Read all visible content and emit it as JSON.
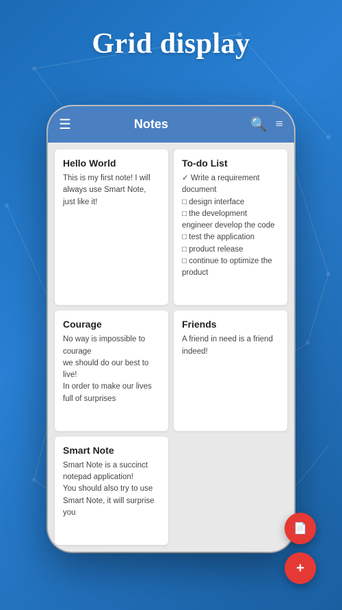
{
  "page": {
    "title": "Grid display",
    "background_color": "#2275c4"
  },
  "app": {
    "bar_title": "Notes",
    "menu_icon": "☰",
    "search_icon": "🔍",
    "filter_icon": "≡"
  },
  "notes": [
    {
      "id": "hello-world",
      "title": "Hello World",
      "body": "This is my first note! I will always use Smart Note, just like it!"
    },
    {
      "id": "to-do-list",
      "title": "To-do List",
      "body": "✓ Write a requirement document\n□ design interface\n□ the development engineer develop the code\n□ test the application\n□ product release\n□ continue to optimize the product"
    },
    {
      "id": "courage",
      "title": "Courage",
      "body": "No way is impossible to courage\nwe should do our best to live!\nIn order to make our lives full of surprises"
    },
    {
      "id": "friends",
      "title": "Friends",
      "body": "A friend in need is a friend indeed!"
    },
    {
      "id": "smart-note",
      "title": "Smart Note",
      "body": "Smart Note is a succinct notepad application!\nYou should also try to use Smart Note, it will surprise you"
    }
  ],
  "fab": {
    "doc_label": "📄",
    "add_label": "+"
  }
}
